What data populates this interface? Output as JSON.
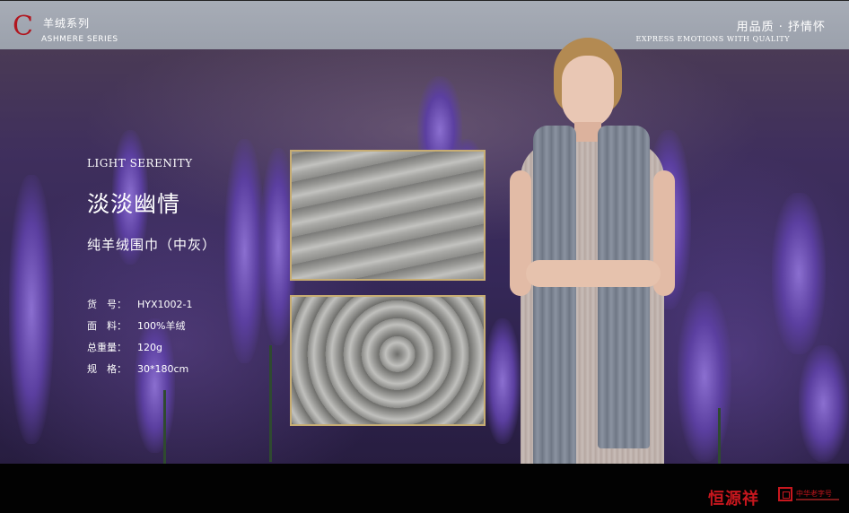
{
  "header": {
    "logo_letter": "C",
    "series_cn": "羊绒系列",
    "series_en": "ASHMERE SERIES",
    "slogan_cn": "用品质 · 抒情怀",
    "slogan_en": "EXPRESS EMOTIONS WITH QUALITY"
  },
  "product": {
    "en_title": "LIGHT SERENITY",
    "cn_title": "淡淡幽情",
    "subtitle": "纯羊绒围巾（中灰）",
    "specs": [
      {
        "label": "货　号：",
        "value": "HYX1002-1"
      },
      {
        "label": "面　料：",
        "value": "100%羊绒"
      },
      {
        "label": "总重量：",
        "value": "120g"
      },
      {
        "label": "规　格：",
        "value": "30*180cm"
      }
    ]
  },
  "footer": {
    "brand": "恒源祥",
    "laozihao": "中华老字号"
  },
  "colors": {
    "accent_red": "#c8171e",
    "swatch_border": "#c7ad73",
    "header_bg": "#a1a6b0"
  }
}
